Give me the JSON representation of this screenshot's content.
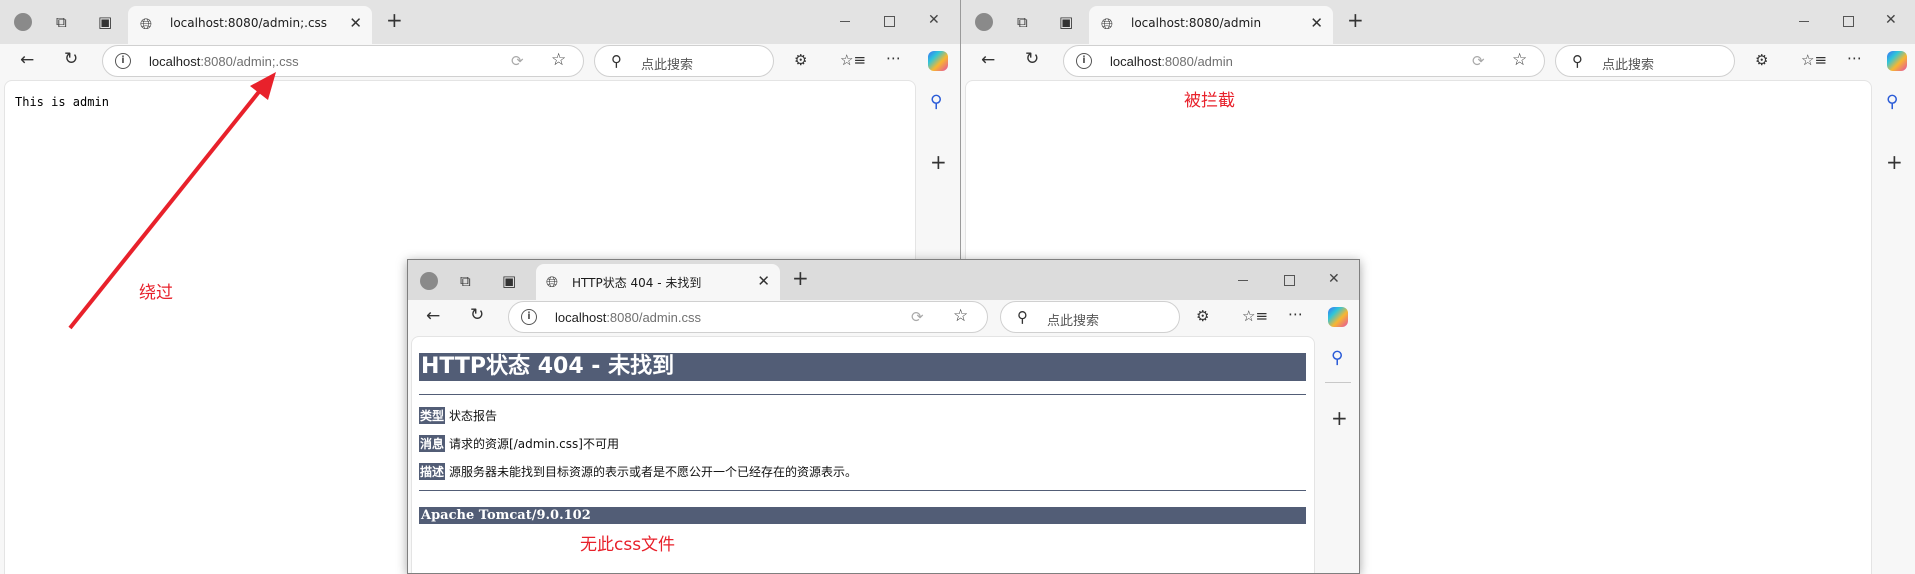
{
  "left_window": {
    "tab_title": "localhost:8080/admin;.css",
    "url_host": "localhost",
    "url_rest": ":8080/admin;.css",
    "search_placeholder": "点此搜索",
    "page_text": "This is admin"
  },
  "right_window": {
    "tab_title": "localhost:8080/admin",
    "url_host": "localhost",
    "url_rest": ":8080/admin",
    "search_placeholder": "点此搜索"
  },
  "front_window": {
    "tab_title": "HTTP状态 404 - 未找到",
    "url_host": "localhost",
    "url_rest": ":8080/admin.css",
    "search_placeholder": "点此搜索",
    "error_page": {
      "heading": "HTTP状态 404 - 未找到",
      "rows": [
        {
          "label": "类型",
          "text": "状态报告"
        },
        {
          "label": "消息",
          "text": "请求的资源[/admin.css]不可用"
        },
        {
          "label": "描述",
          "text": "源服务器未能找到目标资源的表示或者是不愿公开一个已经存在的资源表示。"
        }
      ],
      "footer": "Apache Tomcat/9.0.102"
    }
  },
  "annotations": {
    "bypass": "绕过",
    "blocked": "被拦截",
    "no_css_file": "无此css文件"
  },
  "colors": {
    "annotation_red": "#e8212b",
    "tomcat_header": "#525d76"
  }
}
